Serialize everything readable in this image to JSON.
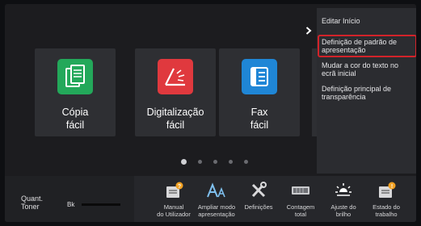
{
  "tiles": [
    {
      "label": "Cópia\nfácil",
      "icon": "copy-icon",
      "color": "#23a85a"
    },
    {
      "label": "Digitalização\nfácil",
      "icon": "scanner-icon",
      "color": "#e0393e"
    },
    {
      "label": "Fax\nfácil",
      "icon": "fax-icon",
      "color": "#1f86d6"
    }
  ],
  "pager": {
    "count": 5,
    "active": 0
  },
  "menu": {
    "items": [
      {
        "label": "Editar Início"
      },
      {
        "label": "Definição de padrão de apresentação",
        "highlighted": true
      },
      {
        "label": "Mudar a cor do texto no ecrã inicial"
      },
      {
        "label": "Definição principal de transparência"
      }
    ]
  },
  "toner": {
    "label": "Quant.\nToner",
    "bk_label": "Bk"
  },
  "bottom_bar": [
    {
      "label": "Manual\ndo Utilizador",
      "icon": "manual-icon"
    },
    {
      "label": "Ampliar modo\napresentação",
      "icon": "text-size-icon"
    },
    {
      "label": "Definições",
      "icon": "settings-tools-icon"
    },
    {
      "label": "Contagem\ntotal",
      "icon": "counter-icon"
    },
    {
      "label": "Ajuste do\nbrilho",
      "icon": "brightness-icon"
    },
    {
      "label": "Estado do\ntrabalho",
      "icon": "job-status-icon"
    }
  ],
  "colors": {
    "accent_orange": "#f0a022",
    "highlight_red": "#d2232a"
  }
}
